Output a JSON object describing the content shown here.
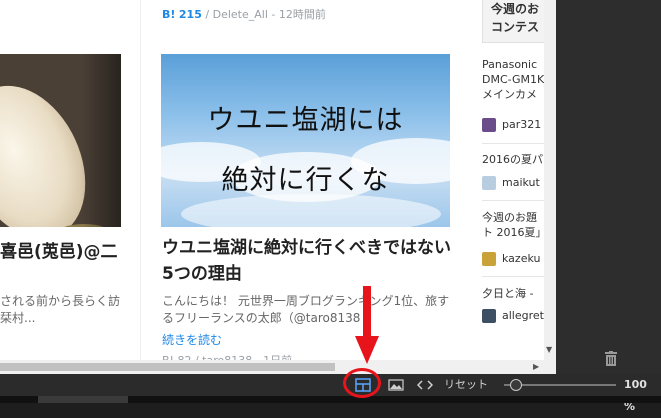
{
  "articles": {
    "top_meta": {
      "hatebu_icon": "B!",
      "count": "215",
      "sep": "/",
      "user": "Delete_All",
      "time": "- 12時間前"
    },
    "left": {
      "title": "喜邑(莵邑)@二",
      "desc_line1": "される前から長らく訪",
      "desc_line2": "栞村..."
    },
    "right": {
      "image_caption_line1": "ウユニ塩湖には",
      "image_caption_line2": "絶対に行くな",
      "title": "ウユニ塩湖に絶対に行くべきではない5つの理由",
      "desc": "こんにちは！ 元世界一周ブログランキング1位、旅するフリーランスの太郎（@taro8138",
      "read_more": "続きを読む",
      "bottom_meta": "B! 82 / taro8138 - 1日前"
    }
  },
  "sidebar": {
    "heading_line1": "今週のお",
    "heading_line2": "コンテス",
    "items": [
      {
        "line1": "Panasonic ",
        "line2": "DMC-GM1K",
        "line3": "メインカメ",
        "user": "par321",
        "avatar_color": "#6b4c8a"
      },
      {
        "line1": "2016の夏パ",
        "user": "maikut",
        "avatar_color": "#b9cde0"
      },
      {
        "line1": "今週のお題",
        "line2": "ト 2016夏」",
        "user": "kazeku",
        "avatar_color": "#c9a23a"
      },
      {
        "line1": "夕日と海 - ",
        "user": "allegret",
        "avatar_color": "#3c4f63"
      }
    ]
  },
  "toolbar": {
    "layout_icon": "layout-icon",
    "image_icon": "image-icon",
    "code_icon": "code-icon",
    "reset_label": "リセット",
    "zoom": "100 %",
    "zoom_level": 0.05
  },
  "colors": {
    "accent_blue": "#1e88e5",
    "annotation_red": "#e8141c"
  }
}
